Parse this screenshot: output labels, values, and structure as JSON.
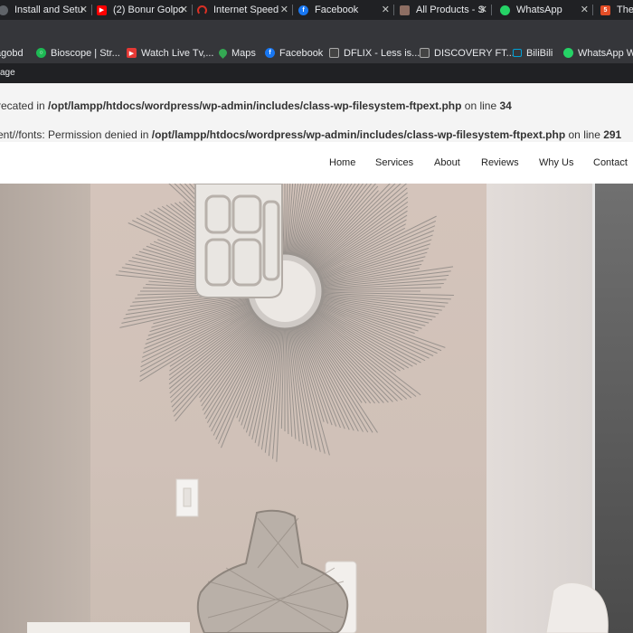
{
  "tabs": [
    {
      "title": "Install and Setu",
      "icon": "github-icon",
      "color": "#5f6368"
    },
    {
      "title": "(2) Bonur Golpo",
      "icon": "youtube-icon",
      "color": "#ff0000"
    },
    {
      "title": "Internet Speed",
      "icon": "speedtest-icon",
      "color": "#d93025"
    },
    {
      "title": "Facebook",
      "icon": "facebook-icon",
      "color": "#1877f2"
    },
    {
      "title": "All Products - S",
      "icon": "box-icon",
      "color": "#8d6e63"
    },
    {
      "title": "WhatsApp",
      "icon": "whatsapp-icon",
      "color": "#25d366"
    },
    {
      "title": "Ther",
      "icon": "html-icon",
      "color": "#e44d26"
    }
  ],
  "bookmarks": [
    {
      "label": "agobd",
      "icon": "globe-icon",
      "color": "#5f6368"
    },
    {
      "label": "Bioscope | Str...",
      "icon": "bioscope-icon",
      "color": "#1db954"
    },
    {
      "label": "Watch Live Tv,...",
      "icon": "tv-icon",
      "color": "#e53935"
    },
    {
      "label": "Maps",
      "icon": "maps-icon",
      "color": "#34a853"
    },
    {
      "label": "Facebook",
      "icon": "facebook-icon",
      "color": "#1877f2"
    },
    {
      "label": "DFLIX - Less is...",
      "icon": "clapper-icon",
      "color": "#444444"
    },
    {
      "label": "DISCOVERY FT...",
      "icon": "clapper-icon",
      "color": "#444444"
    },
    {
      "label": "BiliBili",
      "icon": "bilibili-icon",
      "color": "#00a1d6"
    },
    {
      "label": "WhatsApp W",
      "icon": "whatsapp-icon",
      "color": "#25d366"
    }
  ],
  "page_strip": "age",
  "errors": [
    {
      "prefix": "recated in ",
      "path": "/opt/lampp/htdocs/wordpress/wp-admin/includes/class-wp-filesystem-ftpext.php",
      "mid": " on line ",
      "line": "34"
    },
    {
      "prefix": "ent//fonts: Permission denied in ",
      "path": "/opt/lampp/htdocs/wordpress/wp-admin/includes/class-wp-filesystem-ftpext.php",
      "mid": " on line ",
      "line": "291"
    }
  ],
  "nav": [
    "Home",
    "Services",
    "About",
    "Reviews",
    "Why Us",
    "Contact"
  ],
  "hero": {
    "image": "interior-living-room-photo"
  }
}
